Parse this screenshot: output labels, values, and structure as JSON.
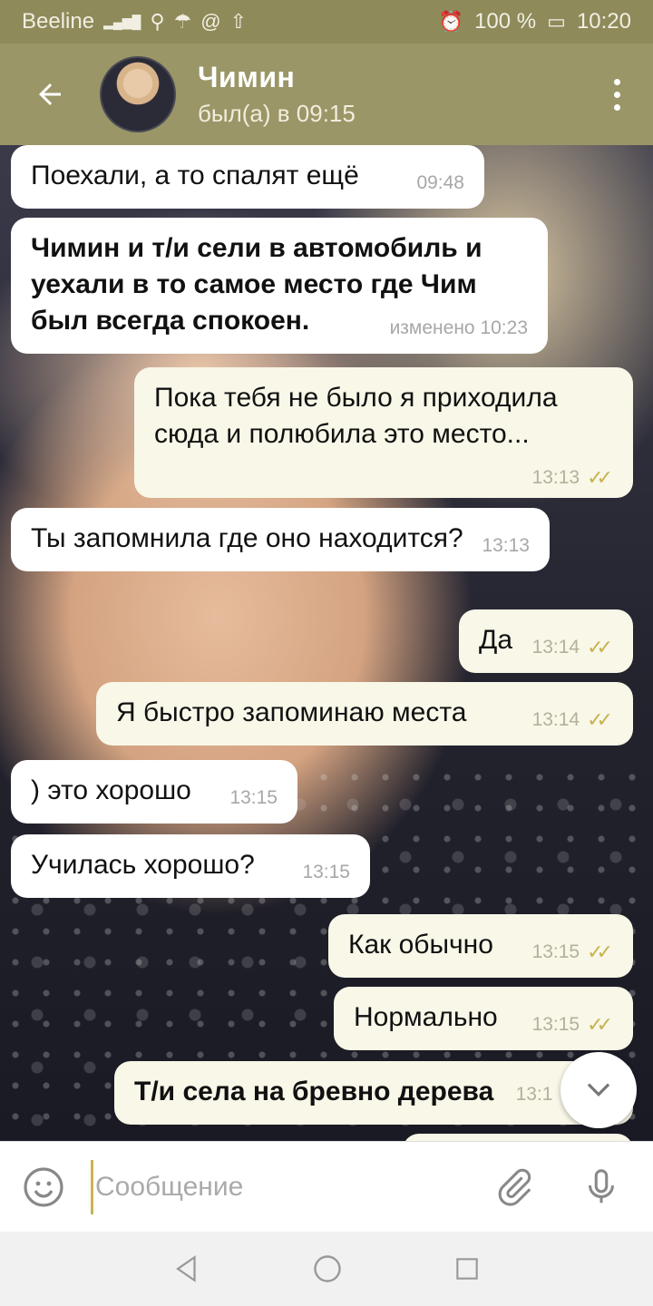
{
  "status_bar": {
    "carrier": "Beeline",
    "network": "4G",
    "battery": "100 %",
    "time": "10:20"
  },
  "header": {
    "name": "Чимин",
    "status": "был(а) в 09:15"
  },
  "messages": [
    {
      "dir": "in",
      "text": "Поехали, а то спалят ещё",
      "time": "09:48"
    },
    {
      "dir": "in",
      "text": "Чимин и т/и сели в автомобиль и уехали в то самое место где Чим был всегда спокоен.",
      "time": "изменено 10:23",
      "bold": true
    },
    {
      "dir": "out",
      "text": "Пока тебя не было я приходила сюда и полюбила это место...",
      "time": "13:13"
    },
    {
      "dir": "in",
      "text": "Ты запомнила где оно находится?",
      "time": "13:13"
    },
    {
      "dir": "out",
      "text": "Да",
      "time": "13:14"
    },
    {
      "dir": "out",
      "text": "Я быстро запоминаю места",
      "time": "13:14"
    },
    {
      "dir": "in",
      "text": ") это хорошо",
      "time": "13:15"
    },
    {
      "dir": "in",
      "text": "Училась хорошо?",
      "time": "13:15"
    },
    {
      "dir": "out",
      "text": "Как обычно",
      "time": "13:15"
    },
    {
      "dir": "out",
      "text": "Нормально",
      "time": "13:15"
    },
    {
      "dir": "out",
      "text": "Т/и села на бревно дерева",
      "time": "13:1",
      "bold": true
    }
  ],
  "input": {
    "placeholder": "Сообщение"
  },
  "icons": {
    "back": "arrow-left-icon",
    "menu": "more-vert-icon",
    "emoji": "smile-icon",
    "attach": "paperclip-icon",
    "mic": "microphone-icon",
    "scroll": "chevron-down-icon"
  },
  "colors": {
    "header": "#9a9667",
    "status_bar": "#8e8a5a",
    "read_check": "#c7b34f"
  }
}
